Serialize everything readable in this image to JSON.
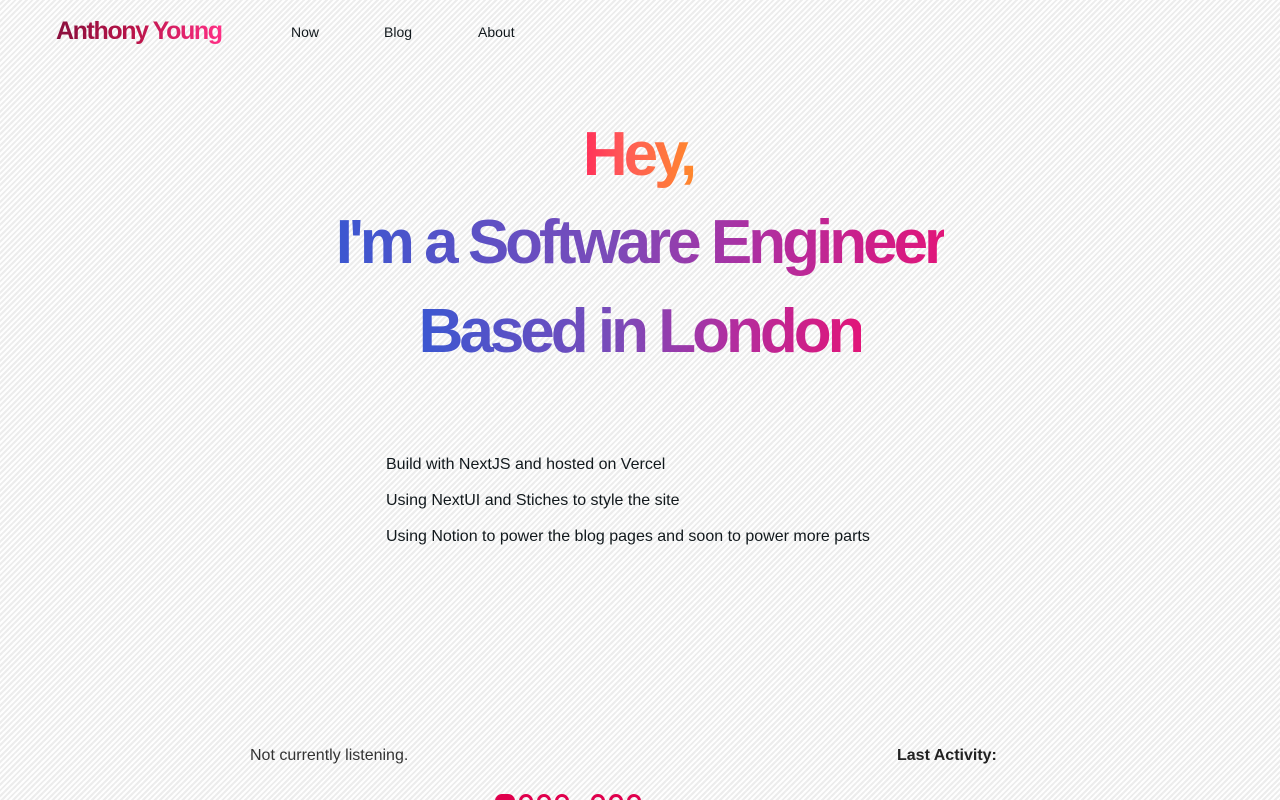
{
  "header": {
    "brand": "Anthony Young",
    "nav": [
      {
        "label": "Now"
      },
      {
        "label": "Blog"
      },
      {
        "label": "About"
      }
    ]
  },
  "hero": {
    "greeting": "Hey,",
    "role_line": "I'm a Software Engineer",
    "location_line": "Based in London"
  },
  "features": [
    "Build with NextJS and hosted on Vercel",
    "Using NextUI and Stiches to style the site",
    "Using Notion to power the blog pages and soon to power more parts"
  ],
  "status": {
    "listening": "Not currently listening.",
    "last_activity_label": "Last Activity:"
  },
  "colors": {
    "brand_start": "#8a0f3d",
    "brand_end": "#ff2f86",
    "hey_start": "#ff2f59",
    "hey_end": "#ff8a2a",
    "headline_start": "#3b57d1",
    "headline_middle": "#7b4bb9",
    "headline_end": "#e11579",
    "activity_accent": "#e0004d"
  }
}
